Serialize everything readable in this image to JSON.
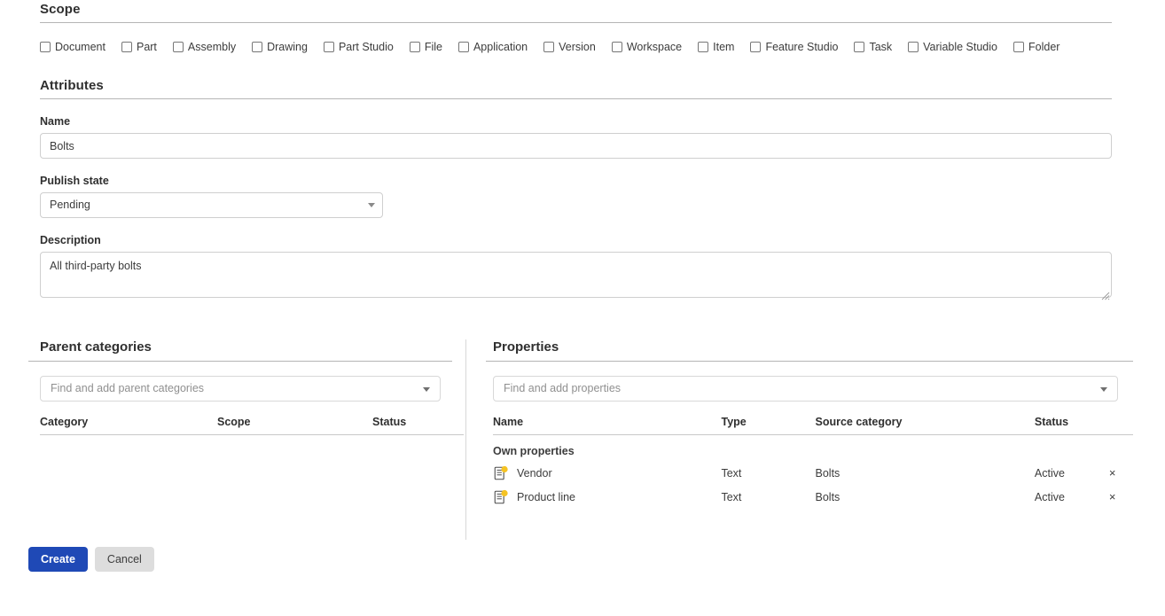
{
  "scope": {
    "heading": "Scope",
    "options": [
      {
        "label": "Document",
        "checked": false
      },
      {
        "label": "Part",
        "checked": false
      },
      {
        "label": "Assembly",
        "checked": false
      },
      {
        "label": "Drawing",
        "checked": false
      },
      {
        "label": "Part Studio",
        "checked": false
      },
      {
        "label": "File",
        "checked": false
      },
      {
        "label": "Application",
        "checked": false
      },
      {
        "label": "Version",
        "checked": false
      },
      {
        "label": "Workspace",
        "checked": false
      },
      {
        "label": "Item",
        "checked": false
      },
      {
        "label": "Feature Studio",
        "checked": false
      },
      {
        "label": "Task",
        "checked": false
      },
      {
        "label": "Variable Studio",
        "checked": false
      },
      {
        "label": "Folder",
        "checked": false
      }
    ]
  },
  "attributes": {
    "heading": "Attributes",
    "name": {
      "label": "Name",
      "value": "Bolts",
      "placeholder": ""
    },
    "publish_state": {
      "label": "Publish state",
      "value": "Pending"
    },
    "description": {
      "label": "Description",
      "value": "All third-party bolts",
      "placeholder": ""
    }
  },
  "parent_categories": {
    "heading": "Parent categories",
    "search_placeholder": "Find and add parent categories",
    "columns": [
      "Category",
      "Scope",
      "Status"
    ],
    "rows": []
  },
  "properties": {
    "heading": "Properties",
    "search_placeholder": "Find and add properties",
    "columns": [
      "Name",
      "Type",
      "Source category",
      "Status"
    ],
    "group_label": "Own properties",
    "rows": [
      {
        "icon": "property-document-icon",
        "name": "Vendor",
        "type": "Text",
        "source_category": "Bolts",
        "status": "Active",
        "remove": "×"
      },
      {
        "icon": "property-document-icon",
        "name": "Product line",
        "type": "Text",
        "source_category": "Bolts",
        "status": "Active",
        "remove": "×"
      }
    ]
  },
  "footer": {
    "create_label": "Create",
    "cancel_label": "Cancel"
  },
  "colors": {
    "primary": "#1f49b6",
    "secondary": "#dddddd",
    "icon_badge": "#f5c324",
    "rule": "#b5b5b5"
  }
}
